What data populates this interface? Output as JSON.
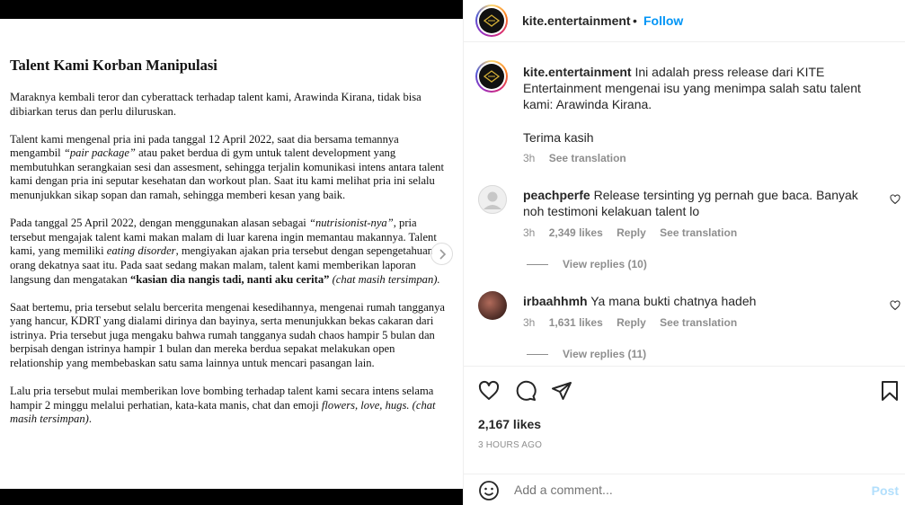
{
  "document": {
    "title": "Talent Kami Korban Manipulasi",
    "paragraphs": [
      [
        {
          "t": "Maraknya kembali teror dan cyberattack terhadap talent kami, Arawinda Kirana, tidak bisa dibiarkan terus dan perlu diluruskan.",
          "s": "n"
        }
      ],
      [
        {
          "t": "Talent kami mengenal pria ini pada tanggal 12 April 2022, saat dia bersama temannya mengambil ",
          "s": "n"
        },
        {
          "t": "“pair package”",
          "s": "i"
        },
        {
          "t": " atau paket berdua di gym untuk talent development yang membutuhkan serangkaian sesi dan assesment, sehingga terjalin komunikasi intens antara talent kami dengan pria ini seputar kesehatan dan workout plan. Saat itu kami melihat pria ini selalu menunjukkan sikap sopan dan ramah, sehingga memberi kesan yang baik.",
          "s": "n"
        }
      ],
      [
        {
          "t": "Pada tanggal 25 April 2022, dengan menggunakan alasan sebagai ",
          "s": "n"
        },
        {
          "t": "“nutrisionist-nya”",
          "s": "i"
        },
        {
          "t": ", pria tersebut mengajak talent kami makan malam di luar karena ingin memantau makannya. Talent kami, yang memiliki ",
          "s": "n"
        },
        {
          "t": "eating disorder",
          "s": "i"
        },
        {
          "t": ", mengiyakan ajakan pria tersebut dengan sepengetahuan orang dekatnya saat itu. Pada saat sedang makan malam, talent kami memberikan laporan langsung dan mengatakan ",
          "s": "n"
        },
        {
          "t": "“kasian dia nangis tadi, nanti aku cerita”",
          "s": "b"
        },
        {
          "t": " ",
          "s": "n"
        },
        {
          "t": "(chat masih tersimpan).",
          "s": "i"
        }
      ],
      [
        {
          "t": "Saat bertemu, pria tersebut selalu bercerita mengenai kesedihannya, mengenai rumah tangganya yang hancur, KDRT yang dialami dirinya dan bayinya, serta menunjukkan bekas cakaran dari istrinya. Pria tersebut juga mengaku bahwa rumah tangganya sudah chaos hampir 5 bulan dan berpisah dengan istrinya hampir 1 bulan dan mereka berdua sepakat melakukan open relationship yang membebaskan satu sama lainnya untuk mencari pasangan lain.",
          "s": "n"
        }
      ],
      [
        {
          "t": "Lalu pria tersebut mulai memberikan love bombing terhadap talent kami secara intens selama hampir 2 minggu melalui perhatian, kata-kata manis, chat dan emoji ",
          "s": "n"
        },
        {
          "t": "flowers, love, hugs. (chat masih tersimpan)",
          "s": "i"
        },
        {
          "t": ".",
          "s": "n"
        }
      ]
    ]
  },
  "header": {
    "username": "kite.entertainment",
    "separator": "•",
    "follow_label": "Follow"
  },
  "caption": {
    "username": "kite.entertainment",
    "text": " Ini adalah press release dari KITE Entertainment mengenai isu yang menimpa salah satu talent kami: Arawinda Kirana.",
    "text2": "Terima kasih",
    "time": "3h",
    "see_translation": "See translation"
  },
  "comments": [
    {
      "username": "peachperfe",
      "text": " Release tersinting yg pernah gue baca. Banyak noh testimoni kelakuan talent lo",
      "time": "3h",
      "likes": "2,349 likes",
      "reply": "Reply",
      "see_translation": "See translation",
      "view_replies": "View replies (10)"
    },
    {
      "username": "irbaahhmh",
      "text": " Ya mana bukti chatnya hadeh",
      "time": "3h",
      "likes": "1,631 likes",
      "reply": "Reply",
      "see_translation": "See translation",
      "view_replies": "View replies (11)"
    }
  ],
  "post": {
    "likes": "2,167 likes",
    "time_ago": "3 HOURS AGO"
  },
  "add_comment": {
    "placeholder": "Add a comment...",
    "post_label": "Post"
  },
  "icons": {
    "next": "chevron-right-icon",
    "like": "heart-icon",
    "comment": "comment-icon",
    "share": "share-icon",
    "save": "bookmark-icon",
    "emoji": "emoji-icon"
  },
  "colors": {
    "follow": "#0095f6",
    "post_disabled": "#b2dffc",
    "muted": "#8e8e8e"
  }
}
